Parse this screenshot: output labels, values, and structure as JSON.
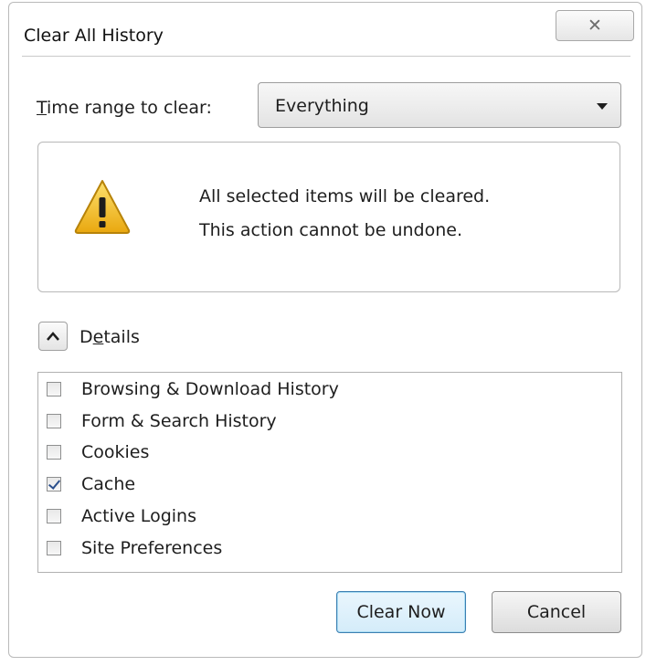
{
  "window": {
    "title": "Clear All History",
    "close_glyph": "✕"
  },
  "time_range": {
    "label": "Time range to clear:",
    "selected": "Everything"
  },
  "warning": {
    "icon": "warning-triangle-icon",
    "line1": "All selected items will be cleared.",
    "line2": "This action cannot be undone."
  },
  "details": {
    "label": "Details",
    "expanded": true,
    "items": [
      {
        "label": "Browsing & Download History",
        "checked": false
      },
      {
        "label": "Form & Search History",
        "checked": false
      },
      {
        "label": "Cookies",
        "checked": false
      },
      {
        "label": "Cache",
        "checked": true
      },
      {
        "label": "Active Logins",
        "checked": false
      },
      {
        "label": "Site Preferences",
        "checked": false
      }
    ]
  },
  "buttons": {
    "clear_now": "Clear Now",
    "cancel": "Cancel"
  },
  "colors": {
    "warning_yellow": "#f2c31a",
    "default_button_border": "#3c7fb1"
  }
}
